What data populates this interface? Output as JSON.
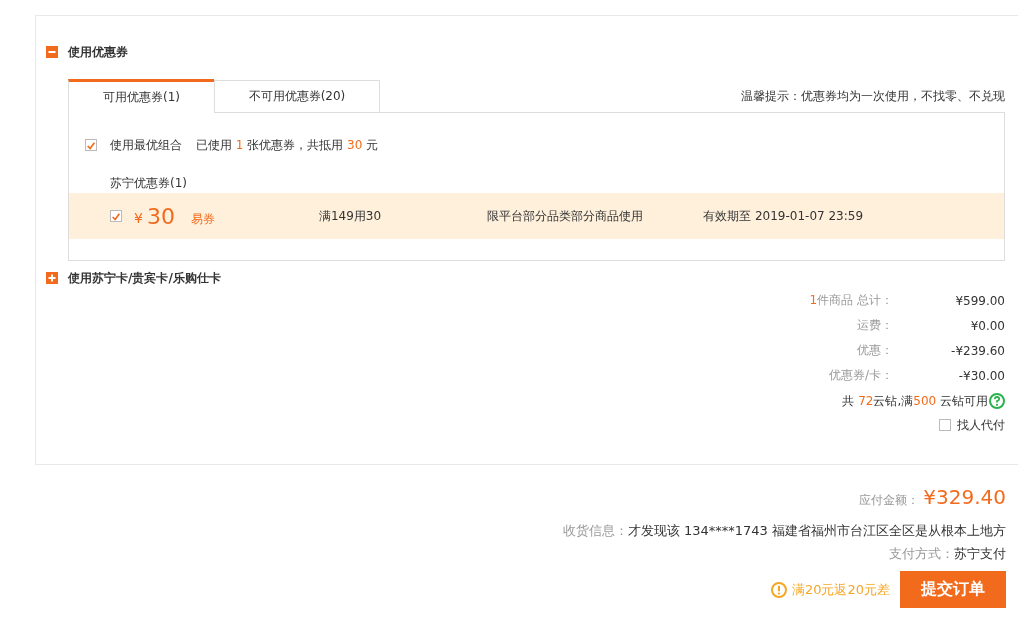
{
  "coupon_section": {
    "expanded": true,
    "title": "使用优惠券",
    "tabs": [
      {
        "label": "可用优惠券(1)",
        "selected": true
      },
      {
        "label": "不可用优惠券(20)",
        "selected": false
      }
    ],
    "tip": "温馨提示：优惠券均为一次使用，不找零、不兑现",
    "best_combo": {
      "checked": true,
      "label": "使用最优组合",
      "summary": [
        {
          "text": "已使用 ",
          "highlight": false
        },
        {
          "text": "1",
          "highlight": true
        },
        {
          "text": " 张优惠券，共抵用 ",
          "highlight": false
        },
        {
          "text": "30",
          "highlight": true
        },
        {
          "text": " 元",
          "highlight": false
        }
      ]
    },
    "group_title": "苏宁优惠券(1)",
    "coupons": [
      {
        "checked": true,
        "currency": "¥",
        "amount": "30",
        "type": "易券",
        "rule": "满149用30",
        "scope": "限平台部分品类部分商品使用",
        "expiry": "有效期至 2019-01-07 23:59"
      }
    ]
  },
  "card_section": {
    "expanded": false,
    "title": "使用苏宁卡/贵宾卡/乐购仕卡"
  },
  "summary": [
    {
      "count": "1",
      "label": "件商品 总计：",
      "value": "¥599.00"
    },
    {
      "label": "运费：",
      "value": "¥0.00"
    },
    {
      "label": "优惠：",
      "value": "-¥239.60"
    },
    {
      "label": "优惠券/卡：",
      "value": "-¥30.00"
    }
  ],
  "coins": [
    {
      "text": "共 ",
      "highlight": false
    },
    {
      "text": "72",
      "highlight": true
    },
    {
      "text": "云钻,满",
      "highlight": false
    },
    {
      "text": "500",
      "highlight": true
    },
    {
      "text": " 云钻可用",
      "highlight": false
    }
  ],
  "pay_for_me": {
    "checked": false,
    "label": "找人代付"
  },
  "total": {
    "label": "应付金额：",
    "value": "¥329.40"
  },
  "shipping": {
    "label": "收货信息：",
    "value": "才发现该 134****1743 福建省福州市台江区全区是从根本上地方"
  },
  "payment": {
    "label": "支付方式：",
    "value": "苏宁支付"
  },
  "promo": "满20元返20元差",
  "submit": "提交订单"
}
